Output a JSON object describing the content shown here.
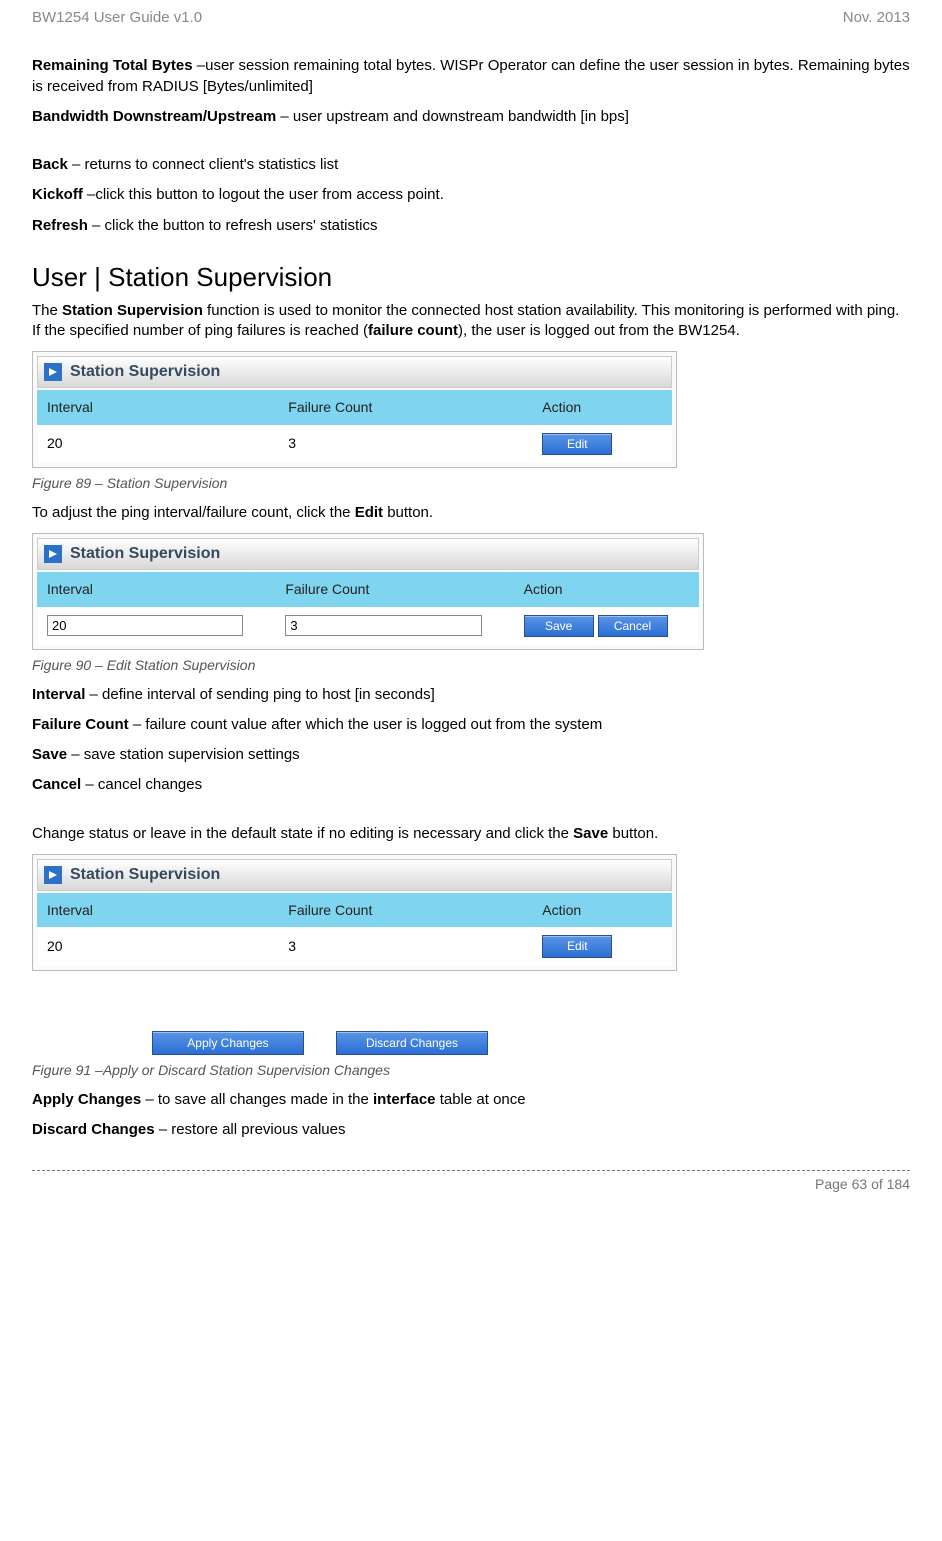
{
  "header": {
    "left": "BW1254 User Guide v1.0",
    "right": "Nov.  2013"
  },
  "p1": {
    "b": "Remaining Total Bytes",
    "t": " –user session remaining total bytes. WISPr Operator can define the user session in bytes. Remaining bytes is received from RADIUS [Bytes/unlimited]"
  },
  "p2": {
    "b": "Bandwidth Downstream/Upstream",
    "t": " – user upstream and downstream bandwidth [in bps]"
  },
  "p3": {
    "b": "Back",
    "t": " – returns to connect client's statistics list"
  },
  "p4": {
    "b": "Kickoff",
    "t": " –click this button to logout the user from access point."
  },
  "p5": {
    "b": "Refresh",
    "t": " – click the button to refresh users' statistics"
  },
  "section_title": "User | Station Supervision",
  "intro": {
    "a": "The ",
    "b": "Station Supervision",
    "c": " function is used to monitor the connected host station availability. This monitoring is performed with ping. If the specified number of ping failures is reached (",
    "d": "failure count",
    "e": "), the user is logged out from the BW1254."
  },
  "panel_title": "Station Supervision",
  "cols": {
    "interval": "Interval",
    "failure": "Failure Count",
    "action": "Action"
  },
  "row": {
    "interval": "20",
    "failure": "3"
  },
  "btn": {
    "edit": "Edit",
    "save": "Save",
    "cancel": "Cancel",
    "apply": "Apply Changes",
    "discard": "Discard Changes"
  },
  "fig89": "Figure 89 – Station Supervision",
  "adjust": {
    "a": "To adjust the ping interval/failure count, click the ",
    "b": "Edit",
    "c": " button."
  },
  "fig90": "Figure 90 – Edit Station Supervision",
  "d1": {
    "b": "Interval",
    "t": " – define interval of sending ping to host [in seconds]"
  },
  "d2": {
    "b": "Failure Count",
    "t": " – failure count value after which the user is logged out from the system"
  },
  "d3": {
    "b": "Save",
    "t": " – save station supervision settings"
  },
  "d4": {
    "b": "Cancel",
    "t": " – cancel changes"
  },
  "change": {
    "a": "Change status or leave in the default state if no editing is necessary and click the ",
    "b": "Save",
    "c": " button."
  },
  "fig91": "Figure 91 –Apply or Discard Station Supervision Changes",
  "f1": {
    "b": "Apply Changes",
    "t1": " – to save all changes made in the ",
    "i": "interface",
    "t2": " table at once"
  },
  "f2": {
    "b": "Discard Changes",
    "t": " – restore all previous values"
  },
  "footer": "Page 63 of 184"
}
